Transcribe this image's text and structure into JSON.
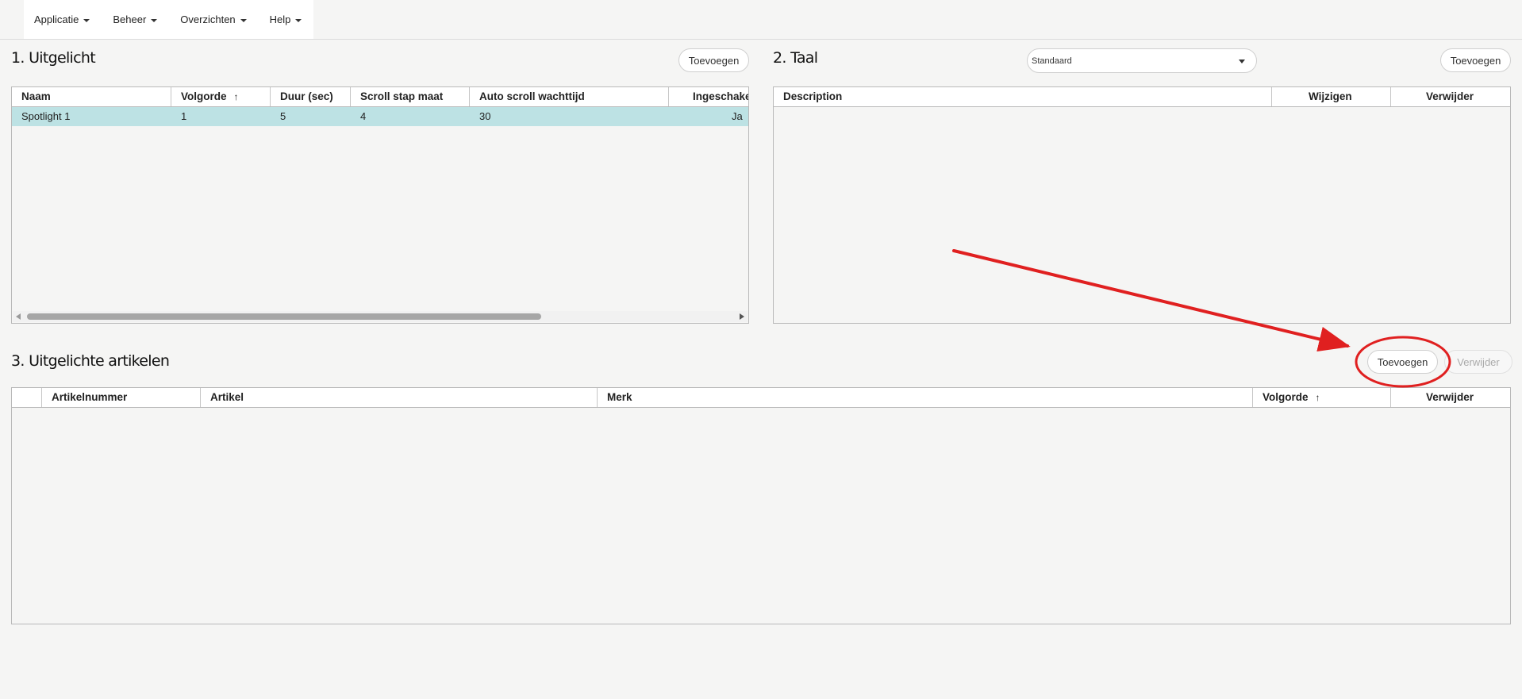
{
  "menu": {
    "items": [
      {
        "label": "Applicatie"
      },
      {
        "label": "Beheer"
      },
      {
        "label": "Overzichten"
      },
      {
        "label": "Help"
      }
    ]
  },
  "section1": {
    "title": "1. Uitgelicht",
    "add_label": "Toevoegen",
    "columns": [
      "Naam",
      "Volgorde",
      "Duur (sec)",
      "Scroll stap maat",
      "Auto scroll wachttijd",
      "Ingeschakeld"
    ],
    "sort_indicator": "↑",
    "rows": [
      {
        "naam": "Spotlight 1",
        "volgorde": "1",
        "duur": "5",
        "scroll_stap": "4",
        "wachttijd": "30",
        "ingeschakeld": "Ja"
      }
    ]
  },
  "section2": {
    "title": "2. Taal",
    "select_value": "Standaard",
    "add_label": "Toevoegen",
    "columns": [
      "Description",
      "Wijzigen",
      "Verwijder"
    ]
  },
  "section3": {
    "title": "3. Uitgelichte artikelen",
    "add_label": "Toevoegen",
    "remove_label": "Verwijder",
    "columns": [
      "",
      "Artikelnummer",
      "Artikel",
      "Merk",
      "Volgorde",
      "Verwijder"
    ],
    "sort_indicator": "↑"
  },
  "icons": {
    "menu_caret": "caret-down-icon",
    "sort": "sort-ascending-icon",
    "select_caret": "chevron-down-icon",
    "scroll_left": "scroll-left-icon",
    "scroll_right": "scroll-right-icon"
  },
  "colors": {
    "background": "#f5f5f4",
    "selected_row": "#bde2e4",
    "annotation": "#e02020"
  }
}
